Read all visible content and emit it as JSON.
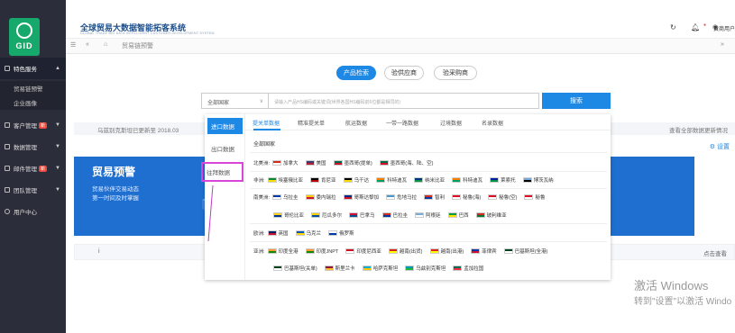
{
  "app": {
    "logo_text": "GID"
  },
  "sidebar": {
    "items": [
      {
        "label": "特色服务",
        "badge": ""
      },
      {
        "label": "客户管理",
        "badge": "新"
      },
      {
        "label": "数据管理",
        "badge": ""
      },
      {
        "label": "邮件管理",
        "badge": "新"
      },
      {
        "label": "团队管理",
        "badge": ""
      },
      {
        "label": "用户中心",
        "badge": ""
      }
    ],
    "sub_items": [
      "贸易链预警",
      "企业画像"
    ]
  },
  "topbar": {
    "title": "全球贸易大数据智能拓客系统",
    "subtitle": "GLOBAL TRADE BIG DATA INTELLIGENT CUSTOMER DEVELOPMENT SYSTEM",
    "user": "黄",
    "user_suffix": "商用户"
  },
  "tabbar": {
    "page_tab": "贸易链预警"
  },
  "main": {
    "pills": [
      "产品检索",
      "验供应商",
      "验采购商"
    ],
    "search_select": "全部国家",
    "search_placeholder": "请输入产品HS编码或关键词(世界各国HS编码前6位都是相同的)",
    "search_button": "搜索",
    "strip_left": "乌兹别克斯坦已更新至 2018.03",
    "strip_right": "查看全部数据更新情况",
    "settings": "设置",
    "banner_title": "贸易预警",
    "banner_line1": "贸易伙伴交易动态",
    "banner_line2": "第一时间及时掌握",
    "table_head_left": "i",
    "table_head_right": "点击查看"
  },
  "dropdown": {
    "left_options": [
      "进口数据",
      "出口数据",
      "往拜数据"
    ],
    "tabs": [
      "提关单数据",
      "精准提关单",
      "航运数据",
      "一带一路数据",
      "过境数据",
      "名录数据"
    ],
    "all_label": "全部国家",
    "rows": [
      {
        "region": "北美洲",
        "countries": [
          {
            "name": "加拿大",
            "colors": [
              "#d52b1e",
              "#fff"
            ]
          },
          {
            "name": "美国",
            "colors": [
              "#3c3b6e",
              "#b22234"
            ]
          },
          {
            "name": "墨西哥(提单)",
            "colors": [
              "#006847",
              "#ce1126"
            ]
          },
          {
            "name": "墨西哥(海、陆、空)",
            "colors": [
              "#006847",
              "#ce1126"
            ]
          }
        ]
      },
      {
        "region": "非洲",
        "countries": [
          {
            "name": "埃塞俄比亚",
            "colors": [
              "#078930",
              "#fcdd09"
            ]
          },
          {
            "name": "肯尼亚",
            "colors": [
              "#000",
              "#bb0000"
            ]
          },
          {
            "name": "乌干达",
            "colors": [
              "#000",
              "#fcdc04"
            ]
          },
          {
            "name": "科特迪瓦",
            "colors": [
              "#f77f00",
              "#009e60"
            ]
          },
          {
            "name": "纳米比亚",
            "colors": [
              "#003580",
              "#009543"
            ]
          },
          {
            "name": "科特迪瓦",
            "colors": [
              "#f77f00",
              "#009e60"
            ]
          },
          {
            "name": "莱索托",
            "colors": [
              "#00209f",
              "#009543"
            ]
          },
          {
            "name": "博茨瓦纳",
            "colors": [
              "#75aadb",
              "#000"
            ]
          }
        ]
      },
      {
        "region": "南美洲",
        "countries": [
          {
            "name": "乌拉圭",
            "colors": [
              "#0038a8",
              "#fff"
            ]
          },
          {
            "name": "委内瑞拉",
            "colors": [
              "#ffcc00",
              "#cf142b"
            ]
          },
          {
            "name": "哥斯达黎加",
            "colors": [
              "#002b7f",
              "#ce1126"
            ]
          },
          {
            "name": "危地马拉",
            "colors": [
              "#4997d0",
              "#fff"
            ]
          },
          {
            "name": "智利",
            "colors": [
              "#d52b1e",
              "#0039a6"
            ]
          },
          {
            "name": "秘鲁(海)",
            "colors": [
              "#d91023",
              "#fff"
            ]
          },
          {
            "name": "秘鲁(空)",
            "colors": [
              "#d91023",
              "#fff"
            ]
          },
          {
            "name": "秘鲁",
            "colors": [
              "#d91023",
              "#fff"
            ]
          }
        ]
      },
      {
        "region": "",
        "countries": [
          {
            "name": "哥伦比亚",
            "colors": [
              "#fcd116",
              "#003893"
            ]
          },
          {
            "name": "厄瓜多尔",
            "colors": [
              "#ffd100",
              "#034ea2"
            ]
          },
          {
            "name": "巴拿马",
            "colors": [
              "#d21034",
              "#005293"
            ]
          },
          {
            "name": "巴拉圭",
            "colors": [
              "#d52b1e",
              "#0038a8"
            ]
          },
          {
            "name": "阿根廷",
            "colors": [
              "#74acdf",
              "#fff"
            ]
          },
          {
            "name": "巴西",
            "colors": [
              "#009c3b",
              "#ffdf00"
            ]
          },
          {
            "name": "玻利维亚",
            "colors": [
              "#d52b1e",
              "#007934"
            ]
          }
        ]
      },
      {
        "region": "欧洲",
        "countries": [
          {
            "name": "英国",
            "colors": [
              "#012169",
              "#c8102e"
            ]
          },
          {
            "name": "乌克兰",
            "colors": [
              "#0057b7",
              "#ffd700"
            ]
          },
          {
            "name": "俄罗斯",
            "colors": [
              "#fff",
              "#0039a6"
            ]
          }
        ]
      },
      {
        "region": "亚洲",
        "countries": [
          {
            "name": "印度全港",
            "colors": [
              "#ff9933",
              "#138808"
            ]
          },
          {
            "name": "印度JNPT",
            "colors": [
              "#ff9933",
              "#138808"
            ]
          },
          {
            "name": "印度尼西亚",
            "colors": [
              "#ce1126",
              "#fff"
            ]
          },
          {
            "name": "越南(出货)",
            "colors": [
              "#da251d",
              "#ffff00"
            ]
          },
          {
            "name": "越南(出港)",
            "colors": [
              "#da251d",
              "#ffff00"
            ]
          },
          {
            "name": "菲律宾",
            "colors": [
              "#0038a8",
              "#ce1126"
            ]
          },
          {
            "name": "巴基斯坦(全港)",
            "colors": [
              "#01411c",
              "#fff"
            ]
          }
        ]
      },
      {
        "region": "",
        "countries": [
          {
            "name": "巴基斯坦(关单)",
            "colors": [
              "#01411c",
              "#fff"
            ]
          },
          {
            "name": "斯里兰卡",
            "colors": [
              "#8d153a",
              "#ffbe29"
            ]
          },
          {
            "name": "哈萨克斯坦",
            "colors": [
              "#00afca",
              "#fec50c"
            ]
          },
          {
            "name": "乌兹别克斯坦",
            "colors": [
              "#0099b5",
              "#1eb53a"
            ]
          },
          {
            "name": "孟加拉国",
            "colors": [
              "#006a4e",
              "#f42a41"
            ]
          }
        ]
      }
    ]
  },
  "watermark": {
    "line1": "激活 Windows",
    "line2": "转到\"设置\"以激活 Windo"
  },
  "colors": {
    "accent": "#1e88e5",
    "sidebar_bg": "#2b2e3a",
    "logo_green": "#17a96b",
    "highlight": "#d944d9"
  }
}
